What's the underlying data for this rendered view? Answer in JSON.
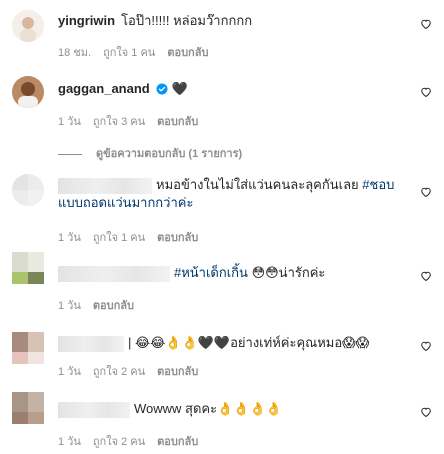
{
  "comments": [
    {
      "username": "yingriwin",
      "text": "โอป๊า!!!!! หล่อมว๊ากกกก",
      "time": "18 ชม.",
      "likes": "ถูกใจ 1 คน",
      "reply": "ตอบกลับ"
    },
    {
      "username": "gaggan_anand",
      "text": "🖤",
      "time": "1 วัน",
      "likes": "ถูกใจ 3 คน",
      "reply": "ตอบกลับ",
      "view_replies": "ดูข้อความตอบกลับ (1 รายการ)"
    },
    {
      "text_a": "หมอข้างในไม่ใส่แว่นคนละลุคกันเลย",
      "hashtag": "#ชอบแบบถอดแว่นมากกว่าค่ะ",
      "time": "1 วัน",
      "likes": "ถูกใจ 1 คน",
      "reply": "ตอบกลับ"
    },
    {
      "hashtag": "#หน้าเด็กเกิ้น",
      "text": "😳😳น่ารักค่ะ",
      "time": "1 วัน",
      "reply": "ตอบกลับ"
    },
    {
      "text": "| 😂😂👌👌🖤🖤อย่างเท่ห์ค่ะคุณหมอ😱😱",
      "time": "1 วัน",
      "likes": "ถูกใจ 2 คน",
      "reply": "ตอบกลับ"
    },
    {
      "text": "Wowww สุดคะ👌👌👌👌",
      "time": "1 วัน",
      "likes": "ถูกใจ 2 คน",
      "reply": "ตอบกลับ"
    }
  ],
  "colors": {
    "text": "#262626",
    "meta": "#8e8e8e",
    "hashtag": "#00376b",
    "verified": "#0095f6"
  }
}
